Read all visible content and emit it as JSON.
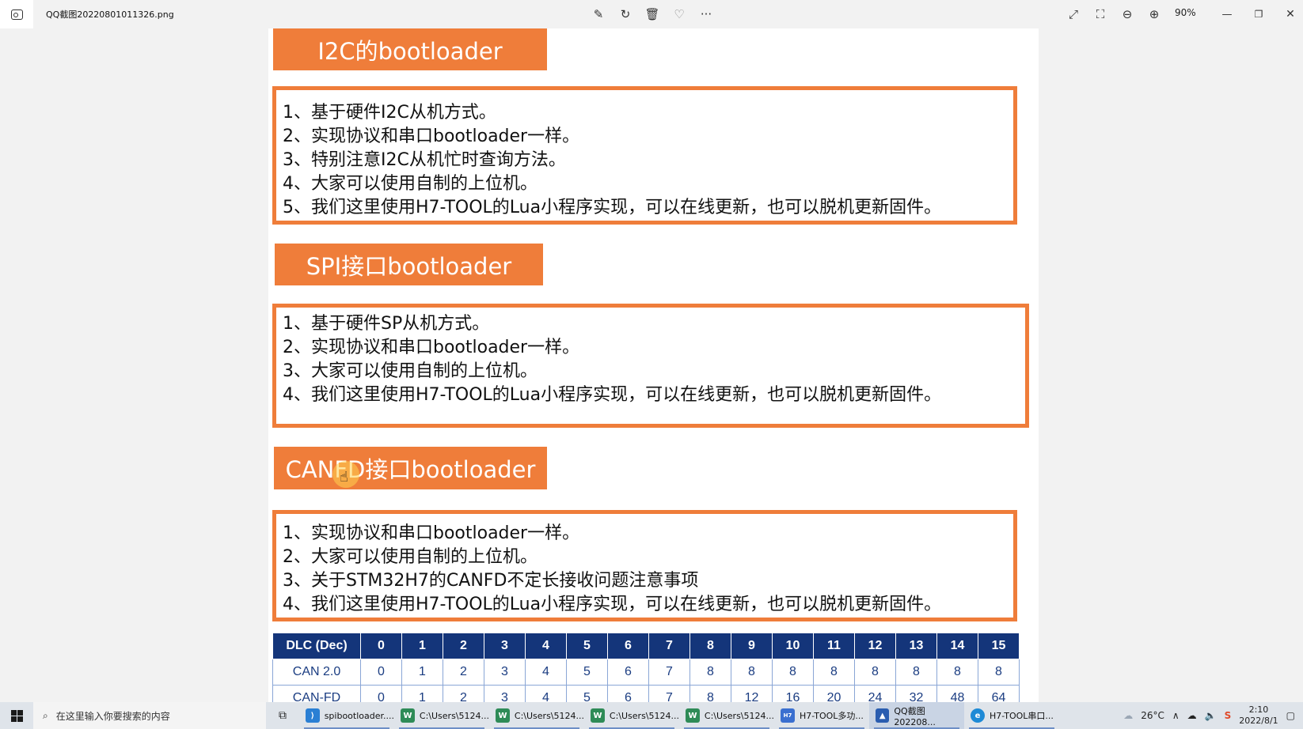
{
  "window": {
    "file_name": "QQ截图20220801011326.png",
    "zoom": "90%",
    "toolbar_icons": [
      "edit-icon",
      "rotate-icon",
      "delete-icon",
      "favorite-icon",
      "more-icon"
    ],
    "right_icons": [
      "expand-icon",
      "crop-icon",
      "zoom-out-icon",
      "zoom-in-icon"
    ],
    "controls": [
      "minimize-icon",
      "restore-icon",
      "close-icon"
    ]
  },
  "slide": {
    "sections": [
      {
        "heading": "I2C的bootloader",
        "lines": [
          "1、基于硬件I2C从机方式。",
          "2、实现协议和串口bootloader一样。",
          "3、特别注意I2C从机忙时查询方法。",
          "4、大家可以使用自制的上位机。",
          "5、我们这里使用H7-TOOL的Lua小程序实现，可以在线更新，也可以脱机更新固件。"
        ]
      },
      {
        "heading": "SPI接口bootloader",
        "lines": [
          "1、基于硬件SP从机方式。",
          "2、实现协议和串口bootloader一样。",
          "3、大家可以使用自制的上位机。",
          "4、我们这里使用H7-TOOL的Lua小程序实现，可以在线更新，也可以脱机更新固件。"
        ]
      },
      {
        "heading": "CANFD接口bootloader",
        "lines": [
          "1、实现协议和串口bootloader一样。",
          "2、大家可以使用自制的上位机。",
          "3、关于STM32H7的CANFD不定长接收问题注意事项",
          "4、我们这里使用H7-TOOL的Lua小程序实现，可以在线更新，也可以脱机更新固件。"
        ]
      }
    ],
    "dlc_table": {
      "header": [
        "DLC (Dec)",
        "0",
        "1",
        "2",
        "3",
        "4",
        "5",
        "6",
        "7",
        "8",
        "9",
        "10",
        "11",
        "12",
        "13",
        "14",
        "15"
      ],
      "rows": [
        [
          "CAN 2.0",
          "0",
          "1",
          "2",
          "3",
          "4",
          "5",
          "6",
          "7",
          "8",
          "8",
          "8",
          "8",
          "8",
          "8",
          "8",
          "8"
        ],
        [
          "CAN-FD",
          "0",
          "1",
          "2",
          "3",
          "4",
          "5",
          "6",
          "7",
          "8",
          "12",
          "16",
          "20",
          "24",
          "32",
          "48",
          "64"
        ]
      ]
    }
  },
  "taskbar": {
    "search_placeholder": "在这里输入你要搜索的内容",
    "items": [
      {
        "label": "spibootloader....",
        "icon": "vscode-icon",
        "color": "#2a7fd4",
        "active": false
      },
      {
        "label": "C:\\Users\\5124...",
        "icon": "winedt-icon",
        "color": "#2e8b57",
        "active": false
      },
      {
        "label": "C:\\Users\\5124...",
        "icon": "winedt-icon",
        "color": "#2e8b57",
        "active": false
      },
      {
        "label": "C:\\Users\\5124...",
        "icon": "winedt-icon",
        "color": "#2e8b57",
        "active": false
      },
      {
        "label": "C:\\Users\\5124...",
        "icon": "winedt-icon",
        "color": "#2e8b57",
        "active": false
      },
      {
        "label": "H7-TOOL多功...",
        "icon": "h7tool-icon",
        "color": "#3a6fd0",
        "active": false
      },
      {
        "label": "QQ截图202208...",
        "icon": "photos-icon",
        "color": "#2a5db0",
        "active": true
      },
      {
        "label": "H7-TOOL串口...",
        "icon": "edge-icon",
        "color": "#1e8ad6",
        "active": false
      }
    ],
    "temperature": "26°C",
    "time": "2:10",
    "date": "2022/8/1"
  }
}
